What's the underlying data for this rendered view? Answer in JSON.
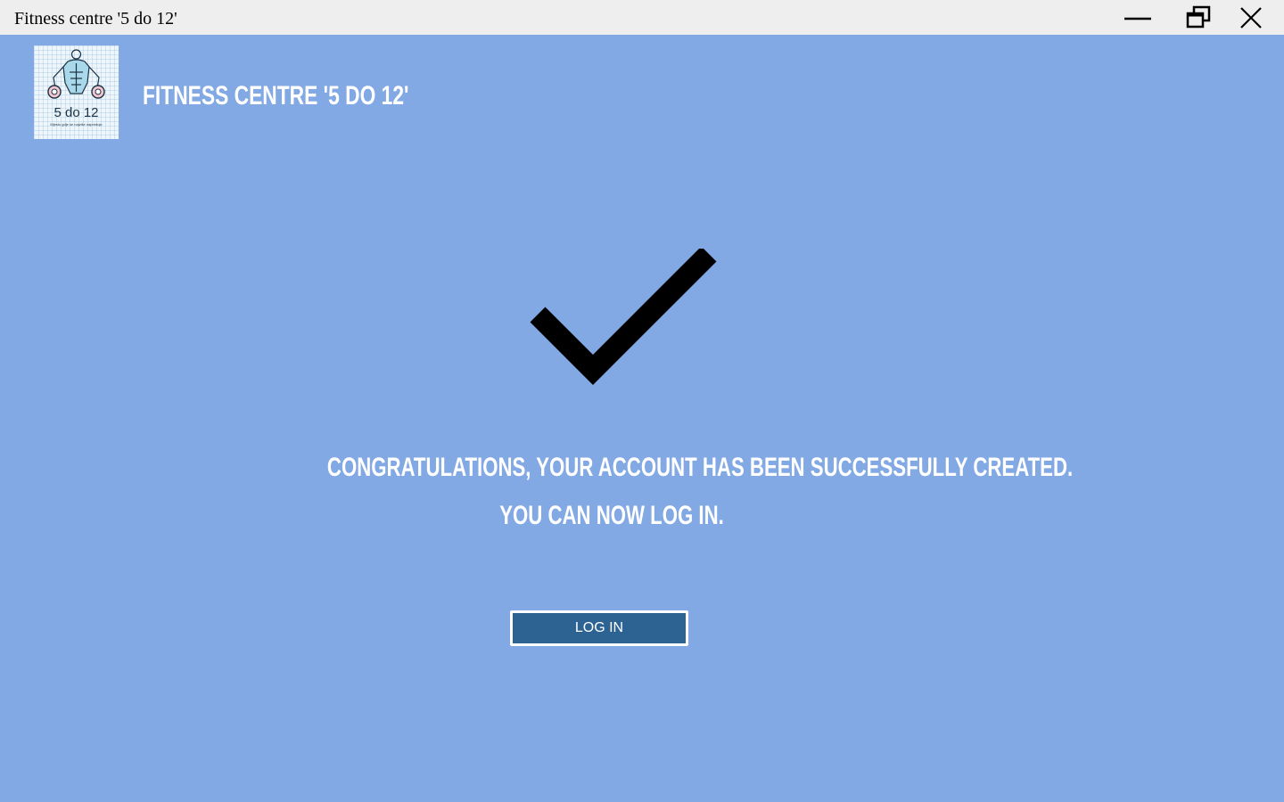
{
  "window": {
    "title": "Fitness centre '5 do 12'",
    "controls": {
      "minimize_icon": "minimize-icon",
      "maximize_icon": "restore-icon",
      "close_icon": "close-icon"
    }
  },
  "header": {
    "logo": {
      "text": "5 do 12",
      "tagline": "Mjesto gdje se najviše napreduje",
      "icon": "muscle-figure-icon"
    },
    "app_title": "Fitness centre '5 do 12'"
  },
  "main": {
    "success_icon": "checkmark-icon",
    "message_line1": "Congratulations, your account has been successfully created.",
    "message_line2": "You can now log in.",
    "login_button_label": "LOG IN"
  },
  "colors": {
    "background": "#82a9e4",
    "titlebar": "#eeeeee",
    "button": "#2c6393",
    "text_light": "#ffffff"
  }
}
